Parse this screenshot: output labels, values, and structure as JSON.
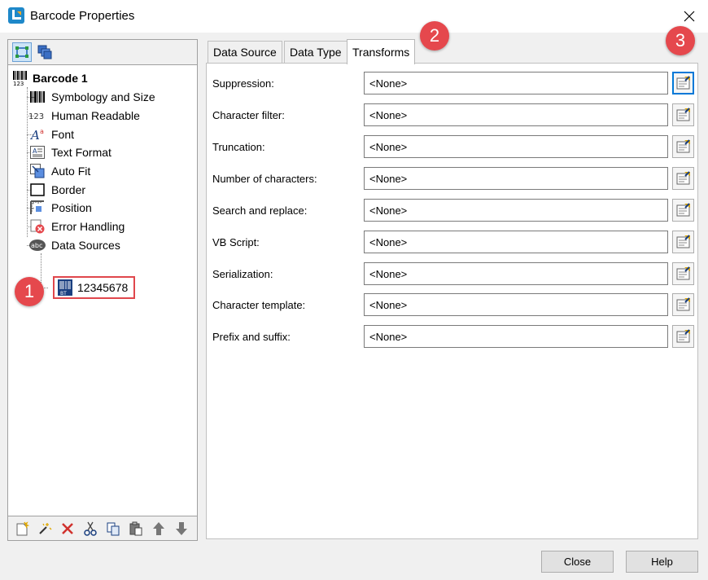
{
  "window": {
    "title": "Barcode Properties"
  },
  "tree": {
    "root": "Barcode 1",
    "items": [
      {
        "label": "Symbology and Size",
        "icon": "barcode-icon"
      },
      {
        "label": "Human Readable",
        "icon": "human-readable-123-icon"
      },
      {
        "label": "Font",
        "icon": "font-icon"
      },
      {
        "label": "Text Format",
        "icon": "text-format-icon"
      },
      {
        "label": "Auto Fit",
        "icon": "auto-fit-icon"
      },
      {
        "label": "Border",
        "icon": "border-icon"
      },
      {
        "label": "Position",
        "icon": "position-icon"
      },
      {
        "label": "Error Handling",
        "icon": "error-handling-icon"
      },
      {
        "label": "Data Sources",
        "icon": "data-sources-icon"
      }
    ],
    "data_source_child": "12345678"
  },
  "badges": {
    "one": "1",
    "two": "2",
    "three": "3"
  },
  "tabs": [
    {
      "label": "Data Source"
    },
    {
      "label": "Data Type"
    },
    {
      "label": "Transforms"
    }
  ],
  "transforms": [
    {
      "label": "Suppression:",
      "value": "<None>"
    },
    {
      "label": "Character filter:",
      "value": "<None>"
    },
    {
      "label": "Truncation:",
      "value": "<None>"
    },
    {
      "label": "Number of characters:",
      "value": "<None>"
    },
    {
      "label": "Search and replace:",
      "value": "<None>"
    },
    {
      "label": "VB Script:",
      "value": "<None>"
    },
    {
      "label": "Serialization:",
      "value": "<None>"
    },
    {
      "label": "Character template:",
      "value": "<None>"
    },
    {
      "label": "Prefix and suffix:",
      "value": "<None>"
    }
  ],
  "buttons": {
    "close": "Close",
    "help": "Help"
  },
  "colors": {
    "badge": "#e5484d",
    "highlight_box": "#e0474c",
    "focus": "#0078d7"
  }
}
